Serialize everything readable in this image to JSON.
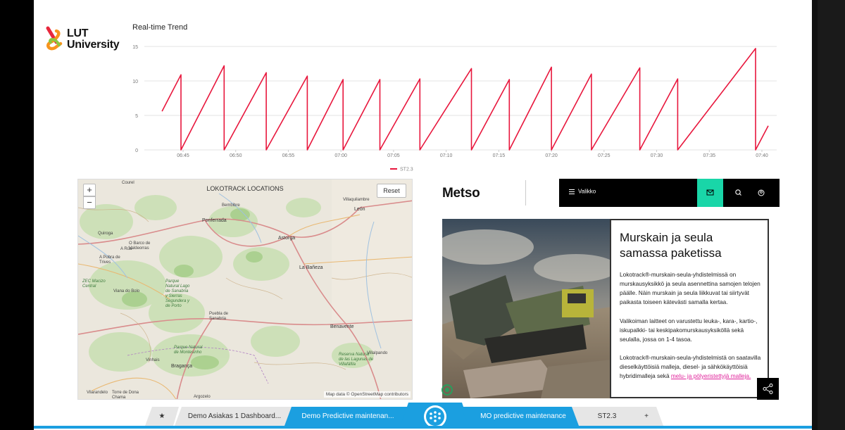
{
  "logo": {
    "line1": "LUT",
    "line2": "University"
  },
  "chart": {
    "title": "Real-time Trend"
  },
  "chart_data": {
    "type": "line",
    "title": "Real-time Trend",
    "xlabel": "",
    "ylabel": "",
    "ylim": [
      0,
      15
    ],
    "x_ticks": [
      "06:45",
      "06:50",
      "06:55",
      "07:00",
      "07:05",
      "07:10",
      "07:15",
      "07:20",
      "07:25",
      "07:30",
      "07:35",
      "07:40"
    ],
    "y_ticks": [
      0,
      5,
      10,
      15
    ],
    "grid": true,
    "legend_position": "bottom-left",
    "series": [
      {
        "name": "ST2.3",
        "color": "#e8173d",
        "peaks": [
          {
            "start_time": "06:43.0",
            "start_value": 5.6,
            "peak_time": "06:44.8",
            "peak_value": 10.9
          },
          {
            "start_time": "06:44.8",
            "start_value": 0.0,
            "peak_time": "06:48.9",
            "peak_value": 12.2
          },
          {
            "start_time": "06:48.9",
            "start_value": 0.0,
            "peak_time": "06:52.9",
            "peak_value": 11.2
          },
          {
            "start_time": "06:52.9",
            "start_value": 0.0,
            "peak_time": "06:56.8",
            "peak_value": 10.7
          },
          {
            "start_time": "06:56.8",
            "start_value": 0.0,
            "peak_time": "07:00.2",
            "peak_value": 10.2
          },
          {
            "start_time": "07:00.2",
            "start_value": 0.0,
            "peak_time": "07:03.7",
            "peak_value": 10.2
          },
          {
            "start_time": "07:03.7",
            "start_value": 0.0,
            "peak_time": "07:07.5",
            "peak_value": 10.3
          },
          {
            "start_time": "07:07.5",
            "start_value": 0.0,
            "peak_time": "07:12.4",
            "peak_value": 11.8
          },
          {
            "start_time": "07:12.4",
            "start_value": 0.0,
            "peak_time": "07:16.0",
            "peak_value": 10.2
          },
          {
            "start_time": "07:16.0",
            "start_value": 0.0,
            "peak_time": "07:20.0",
            "peak_value": 12.0
          },
          {
            "start_time": "07:20.0",
            "start_value": 0.0,
            "peak_time": "07:23.8",
            "peak_value": 11.0
          },
          {
            "start_time": "07:23.8",
            "start_value": 0.0,
            "peak_time": "07:28.4",
            "peak_value": 11.9
          },
          {
            "start_time": "07:28.4",
            "start_value": 0.0,
            "peak_time": "07:32.0",
            "peak_value": 10.3
          },
          {
            "start_time": "07:32.0",
            "start_value": 0.0,
            "peak_time": "07:39.4",
            "peak_value": 14.7
          },
          {
            "start_time": "07:39.4",
            "start_value": 0.0,
            "peak_time": "07:40.6",
            "peak_value": 3.5
          }
        ]
      }
    ]
  },
  "map": {
    "title": "LOKOTRACK LOCATIONS",
    "zoom_in": "+",
    "zoom_out": "−",
    "reset": "Reset",
    "attribution": "Map data © OpenStreetMap contributors",
    "places": [
      "Courel",
      "Bembibre",
      "Villaquilambre",
      "León",
      "Ponferrada",
      "Quiroga",
      "O Barco de Valdeorras",
      "A Rúa",
      "Astorga",
      "A Pobra de Trives",
      "La Bañeza",
      "ZEC Macizo Central",
      "Viana do Bolo",
      "Parque Natural Lago de Sanabria y Sierras Segundera y de Porto",
      "Puebla de Sanabria",
      "Benavente",
      "Parque Natural de Montesinho",
      "Reserva Natural de las Lagunas de Villafáfila",
      "Vinhais",
      "Bragança",
      "Villalpando",
      "Vilarandelo",
      "Torre de Dona Chama",
      "Argozelo"
    ]
  },
  "metso": {
    "logo": "Metso",
    "menu_label": "Valikko",
    "hero_title": "Murskain ja seula samassa paketissa",
    "p1": "Lokotrack®-murskain-seula-yhdistelmissä on murskausyksikkö ja seula asennettina samojen telojen päälle. Näin murskain ja seula liikkuvat tai siirtyvät paikasta toiseen kätevästi samalla kertaa.",
    "p2": "Valikoiman laitteet on varustettu leuka-, kara-, kartio-, iskupalkki- tai keskipakomurskausyksiköllä sekä seulalla, jossa on 1-4 tasoa.",
    "p3_text": "Lokotrack®-murskain-seula-yhdistelmistä on saatavilla dieselkäyttöisiä malleja, diesel- ja sähkökäyttöisiä hybridimalleja sekä ",
    "p3_link": "melu- ja pölyeristettyjä malleja."
  },
  "tabs": {
    "star": "★",
    "t1": "Demo Asiakas 1 Dashboard...",
    "t2": "Demo Predictive maintenan...",
    "t3": "MO predictive maintenance",
    "t4": "ST2.3",
    "add": "+"
  },
  "colors": {
    "accent": "#1b9fe0",
    "line": "#e8173d",
    "metso_green": "#19d6a8",
    "link": "#e0219a"
  }
}
